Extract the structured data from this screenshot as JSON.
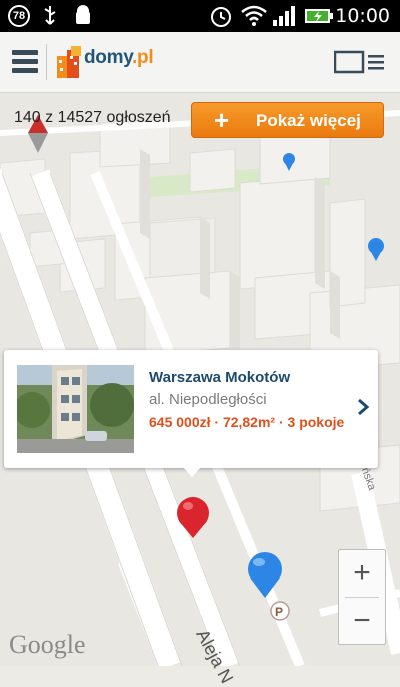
{
  "status_bar": {
    "notification_count": "78",
    "time": "10:00"
  },
  "app_bar": {
    "logo_text": "domy",
    "logo_tld": ".pl",
    "menu_icon": "hamburger-icon",
    "view_icon": "list-view-icon"
  },
  "results": {
    "counter": "140 z 14527 ogłoszeń",
    "show_more_label": "Pokaż więcej"
  },
  "listing": {
    "title": "Warszawa Mokotów",
    "street": "al. Niepodległości",
    "details": "645 000zł · 72,82m² · 3 pokoje"
  },
  "map": {
    "attribution": "Google",
    "street_label": "Aleja N",
    "side_street_label": "ńska",
    "parking_marker": "P",
    "zoom_in": "+",
    "zoom_out": "−"
  },
  "colors": {
    "accent_orange": "#f28c1c",
    "brand_blue": "#22577a",
    "price_red": "#e24f1b",
    "marker_red": "#d9252b",
    "marker_blue": "#2d86e6"
  }
}
